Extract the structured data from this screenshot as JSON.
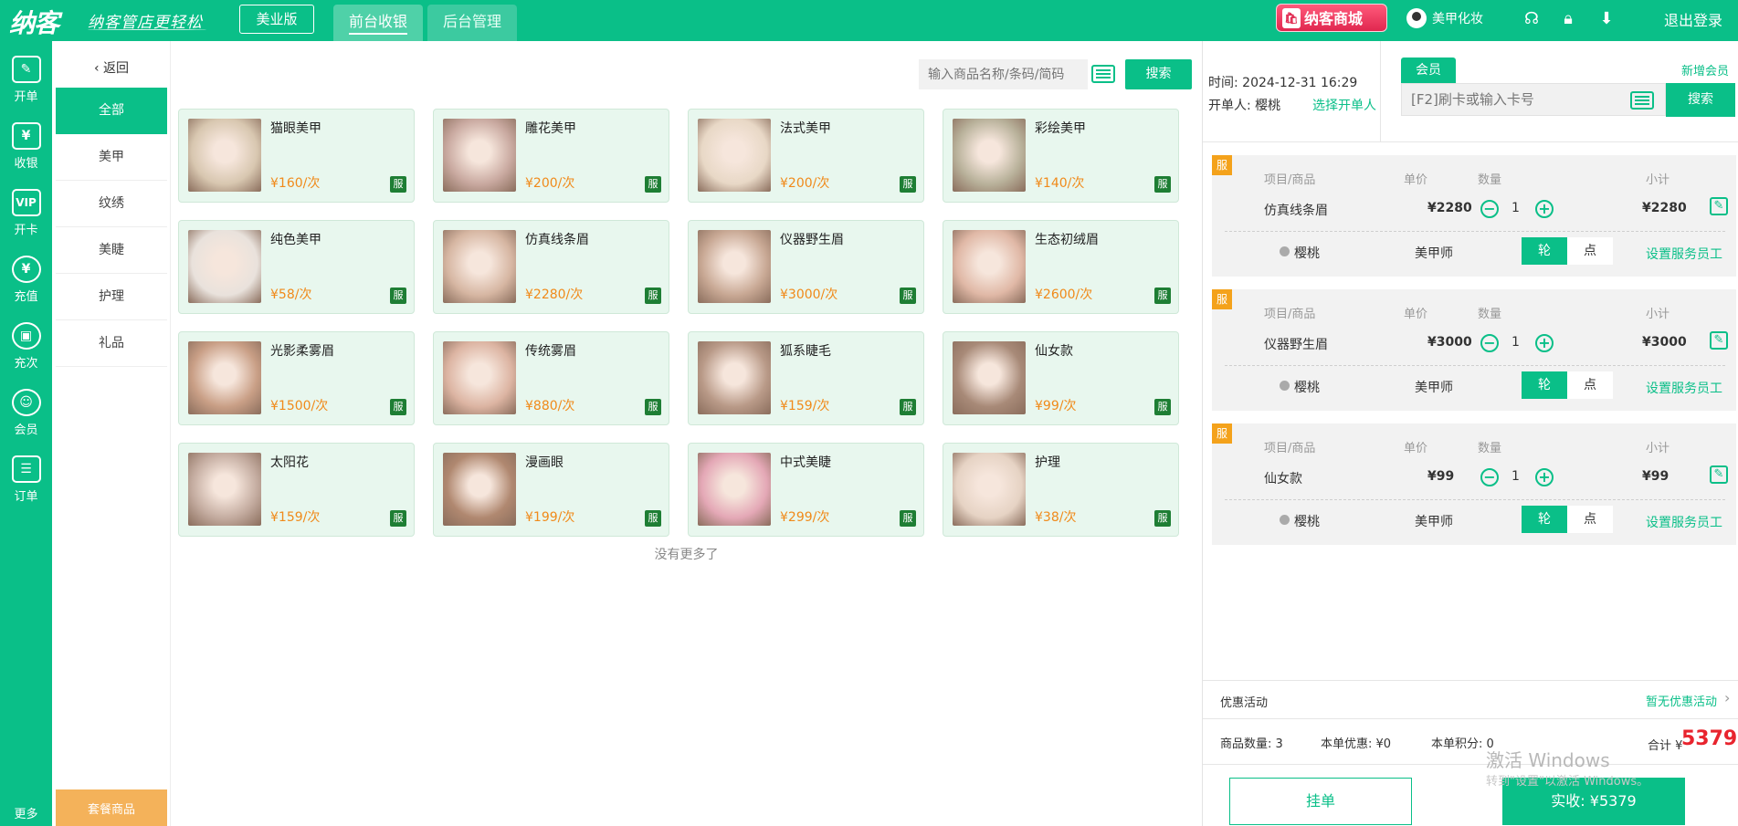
{
  "header": {
    "logo": "纳客",
    "slogan": "纳客管店更轻松",
    "edition": "美业版",
    "tabs": [
      {
        "label": "前台收银"
      },
      {
        "label": "后台管理"
      }
    ],
    "mall": "纳客商城",
    "user": "美甲化妆",
    "logout": "退出登录"
  },
  "leftnav": {
    "items": [
      {
        "label": "开单",
        "icon": "open-order-icon"
      },
      {
        "label": "收银",
        "icon": "cashier-icon"
      },
      {
        "label": "开卡",
        "icon": "vip-card-icon"
      },
      {
        "label": "充值",
        "icon": "recharge-icon"
      },
      {
        "label": "充次",
        "icon": "recharge-times-icon"
      },
      {
        "label": "会员",
        "icon": "member-icon"
      },
      {
        "label": "订单",
        "icon": "order-icon"
      }
    ],
    "more": "更多"
  },
  "categories": {
    "back": "返回",
    "items": [
      {
        "label": "全部"
      },
      {
        "label": "美甲"
      },
      {
        "label": "纹绣"
      },
      {
        "label": "美睫"
      },
      {
        "label": "护理"
      },
      {
        "label": "礼品"
      }
    ],
    "combo": "套餐商品"
  },
  "search": {
    "placeholder": "输入商品名称/条码/简码",
    "button": "搜索"
  },
  "products": [
    {
      "name": "猫眼美甲",
      "price": "¥160/次",
      "tag": "服",
      "color": "#d8c7b0"
    },
    {
      "name": "雕花美甲",
      "price": "¥200/次",
      "tag": "服",
      "color": "#c9a9a0"
    },
    {
      "name": "法式美甲",
      "price": "¥200/次",
      "tag": "服",
      "color": "#e8d8c6"
    },
    {
      "name": "彩绘美甲",
      "price": "¥140/次",
      "tag": "服",
      "color": "#b9b29b"
    },
    {
      "name": "纯色美甲",
      "price": "¥58/次",
      "tag": "服",
      "color": "#e9e2dc"
    },
    {
      "name": "仿真线条眉",
      "price": "¥2280/次",
      "tag": "服",
      "color": "#d6b6a2"
    },
    {
      "name": "仪器野生眉",
      "price": "¥3000/次",
      "tag": "服",
      "color": "#c8a894"
    },
    {
      "name": "生态初绒眉",
      "price": "¥2600/次",
      "tag": "服",
      "color": "#e0b8a6"
    },
    {
      "name": "光影柔雾眉",
      "price": "¥1500/次",
      "tag": "服",
      "color": "#c99f86"
    },
    {
      "name": "传统雾眉",
      "price": "¥880/次",
      "tag": "服",
      "color": "#dcb4a2"
    },
    {
      "name": "狐系睫毛",
      "price": "¥159/次",
      "tag": "服",
      "color": "#b99a88"
    },
    {
      "name": "仙女款",
      "price": "¥99/次",
      "tag": "服",
      "color": "#a88a78"
    },
    {
      "name": "太阳花",
      "price": "¥159/次",
      "tag": "服",
      "color": "#c4aca0"
    },
    {
      "name": "漫画眼",
      "price": "¥199/次",
      "tag": "服",
      "color": "#b08870"
    },
    {
      "name": "中式美睫",
      "price": "¥299/次",
      "tag": "服",
      "color": "#e4a8b6"
    },
    {
      "name": "护理",
      "price": "¥38/次",
      "tag": "服",
      "color": "#e6d3c4"
    }
  ],
  "no_more": "没有更多了",
  "right": {
    "time": "时间:  2024-12-31 16:29",
    "opener": "开单人:  樱桃",
    "choose_opener": "选择开单人",
    "member_tab": "会员",
    "new_member": "新增会员",
    "card_placeholder": "[F2]刷卡或输入卡号",
    "search_btn": "搜索",
    "col_item": "项目/商品",
    "col_price": "单价",
    "col_qty": "数量",
    "col_subtotal": "小计",
    "orders": [
      {
        "tag": "服",
        "name": "仿真线条眉",
        "price": "¥2280",
        "qty": "1",
        "subtotal": "¥2280",
        "staff": "樱桃",
        "role": "美甲师",
        "turn": "轮",
        "point": "点",
        "set_staff": "设置服务员工"
      },
      {
        "tag": "服",
        "name": "仪器野生眉",
        "price": "¥3000",
        "qty": "1",
        "subtotal": "¥3000",
        "staff": "樱桃",
        "role": "美甲师",
        "turn": "轮",
        "point": "点",
        "set_staff": "设置服务员工"
      },
      {
        "tag": "服",
        "name": "仙女款",
        "price": "¥99",
        "qty": "1",
        "subtotal": "¥99",
        "staff": "樱桃",
        "role": "美甲师",
        "turn": "轮",
        "point": "点",
        "set_staff": "设置服务员工"
      }
    ],
    "promo_label": "优惠活动",
    "promo_value": "暂无优惠活动",
    "goods_count": "商品数量:  3",
    "discount": "本单优惠:  ¥0",
    "points": "本单积分:  0",
    "total_label": "合计 ¥",
    "total_value": "5379",
    "watermark": "激活 Windows",
    "watermark_sub": "转到\"设置\"以激活 Windows。",
    "hold": "挂单",
    "pay": "实收: ¥5379"
  },
  "colors": {
    "primary": "#0abf88",
    "price": "#f08a1a",
    "total": "#e8242e",
    "tag": "#f4a21b"
  }
}
